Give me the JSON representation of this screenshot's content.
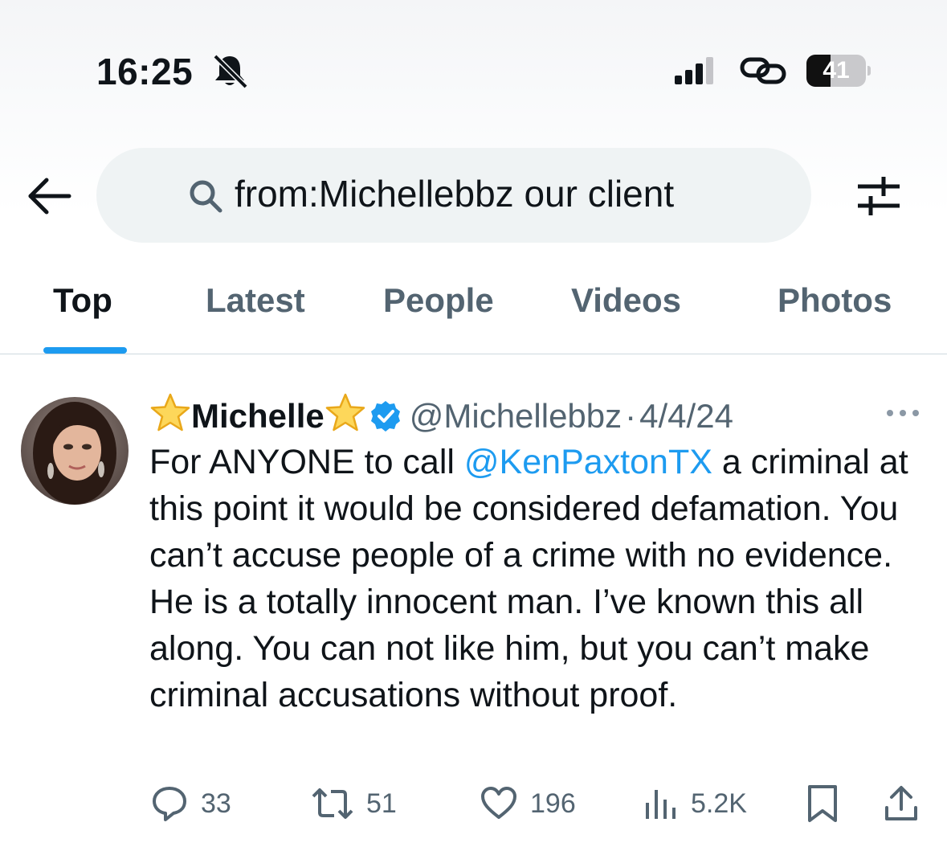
{
  "status_bar": {
    "time": "16:25",
    "battery": "41",
    "battery_level": 0.41,
    "icons": [
      "bell-slash-icon",
      "signal-bars-icon",
      "link-icon",
      "battery-icon"
    ]
  },
  "search": {
    "query": "from:Michellebbz our client",
    "icons": [
      "back-arrow-icon",
      "search-icon",
      "filter-sliders-icon"
    ]
  },
  "tabs": [
    {
      "label": "Top",
      "active": true
    },
    {
      "label": "Latest",
      "active": false
    },
    {
      "label": "People",
      "active": false
    },
    {
      "label": "Videos",
      "active": false
    },
    {
      "label": "Photos",
      "active": false
    }
  ],
  "tweet": {
    "display_name": "Michelle",
    "handle": "@Michellebbz",
    "separator": "·",
    "date": "4/4/24",
    "text_before": "For ANYONE to call ",
    "mention": "@KenPaxtonTX",
    "text_after": " a criminal at this point it would be considered defamation. You can’t accuse people of a crime with no evidence. He is a totally innocent man. I’ve known this all along. You can not like him, but you can’t make criminal accusations without proof.",
    "actions": {
      "replies": "33",
      "reposts": "51",
      "likes": "196",
      "views": "5.2K"
    },
    "accent_color": "#1d9bf0",
    "muted_color": "#536471"
  }
}
